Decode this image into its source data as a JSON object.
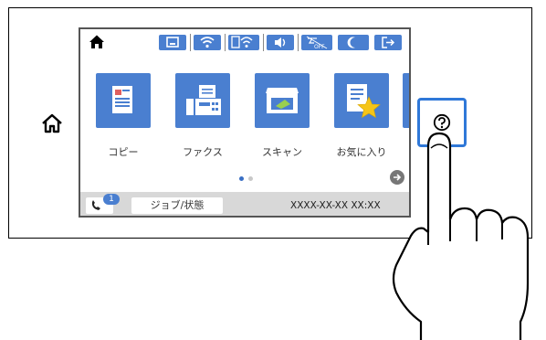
{
  "screen": {
    "tiles": [
      {
        "label": "コピー",
        "icon": "copy-icon"
      },
      {
        "label": "ファクス",
        "icon": "fax-icon"
      },
      {
        "label": "スキャン",
        "icon": "scan-icon"
      },
      {
        "label": "お気に入り",
        "icon": "favorites-icon"
      }
    ],
    "status_icons": [
      "paper-setting-icon",
      "wifi-icon",
      "wifi-direct-icon",
      "volume-icon",
      "quiet-off-icon",
      "sleep-moon-icon",
      "logout-icon"
    ],
    "bottombar": {
      "badge_count": "1",
      "job_label": "ジョブ/状態",
      "datetime": "XXXX-XX-XX XX:XX"
    }
  },
  "colors": {
    "accent": "#4a7fd0",
    "highlight": "#2f78d8"
  }
}
